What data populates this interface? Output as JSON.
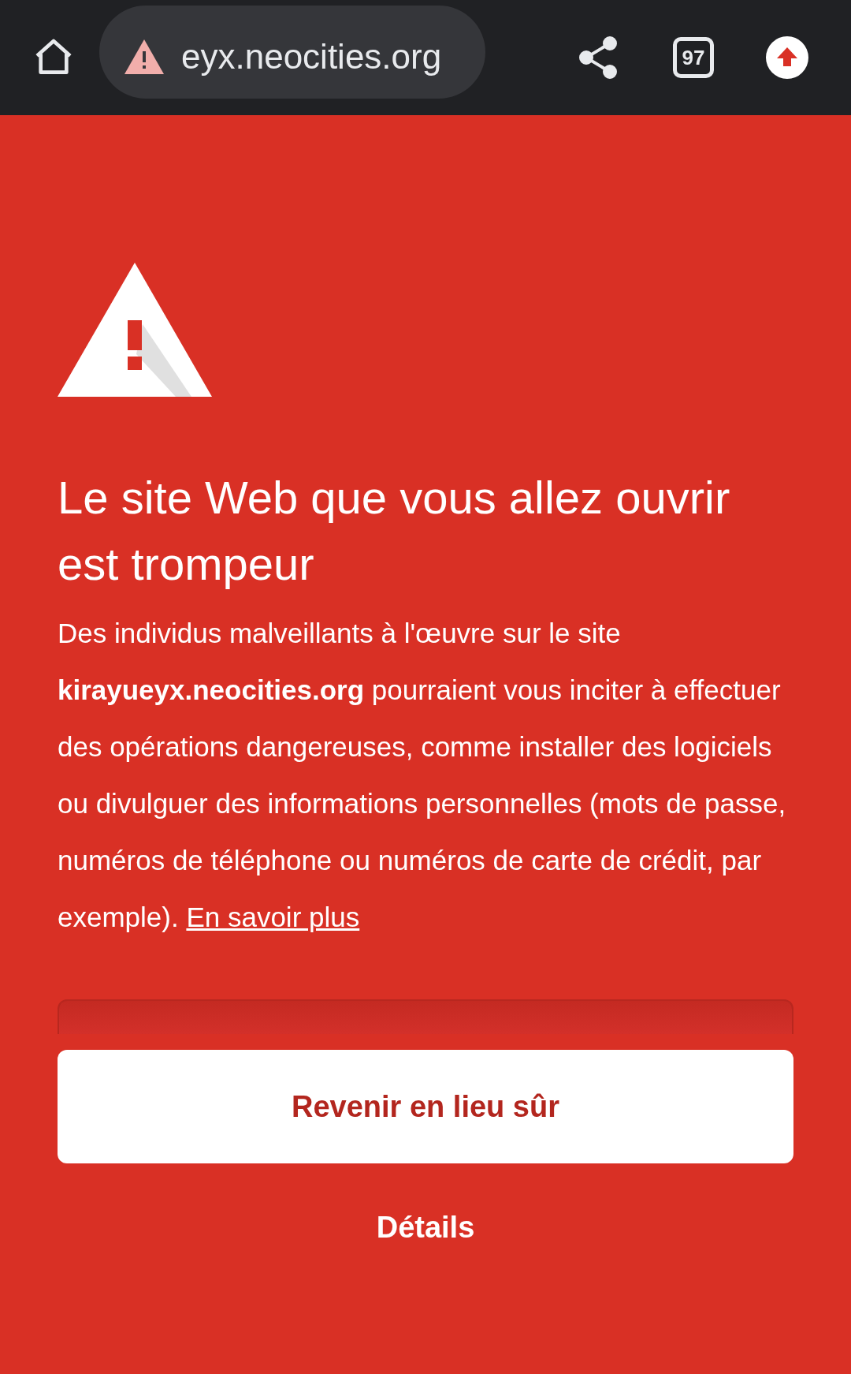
{
  "toolbar": {
    "url": "eyx.neocities.org",
    "security_warning": true,
    "tab_count": "97"
  },
  "warning": {
    "title": "Le site Web que vous allez ouvrir est trompeur",
    "body": "Des individus malveillants à l'œuvre sur le site **kirayueyx.neocities.org** pourraient vous inciter à effectuer des opérations dangereuses, comme installer des logiciels ou divulguer des informations personnelles (mots de passe, numéros de téléphone ou numéros de carte de crédit, par exemple).",
    "link": "En savoir plus"
  },
  "buttons": [
    {
      "kind": "primary",
      "label": "Revenir en lieu sûr"
    },
    {
      "kind": "text",
      "label": "Détails"
    }
  ]
}
